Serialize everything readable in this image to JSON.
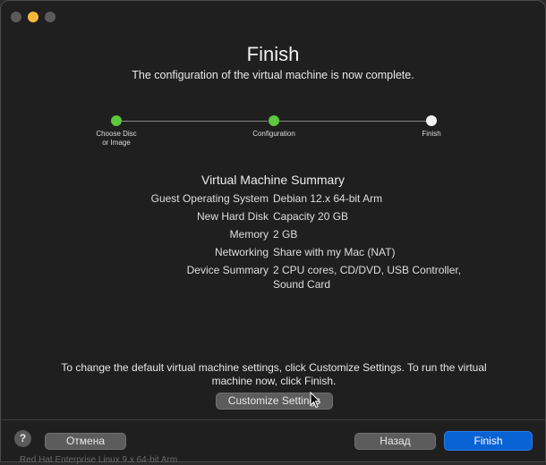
{
  "header": {
    "title": "Finish",
    "subtitle": "The configuration of the virtual machine is now complete."
  },
  "steps": [
    {
      "label": "Choose Disc\nor Image",
      "state": "done"
    },
    {
      "label": "Configuration",
      "state": "done"
    },
    {
      "label": "Finish",
      "state": "current"
    }
  ],
  "summary": {
    "title": "Virtual Machine Summary",
    "rows": [
      {
        "key": "Guest Operating System",
        "value": "Debian 12.x 64-bit Arm"
      },
      {
        "key": "New Hard Disk",
        "value": "Capacity 20 GB"
      },
      {
        "key": "Memory",
        "value": "2 GB"
      },
      {
        "key": "Networking",
        "value": "Share with my Mac (NAT)"
      },
      {
        "key": "Device Summary",
        "value": "2 CPU cores, CD/DVD, USB Controller, Sound Card"
      }
    ]
  },
  "note": "To change the default virtual machine settings, click Customize Settings. To run the virtual machine now, click Finish.",
  "buttons": {
    "customize": "Customize Settings",
    "help": "?",
    "cancel": "Отмена",
    "back": "Назад",
    "finish": "Finish"
  },
  "background_text": "Red Hat Enterprise Linux 9.x 64-bit Arm",
  "colors": {
    "step_done": "#5dc73d",
    "step_current": "#f2f2f2",
    "primary_button": "#0a63d4",
    "minimize_dot": "#f5b93a"
  }
}
